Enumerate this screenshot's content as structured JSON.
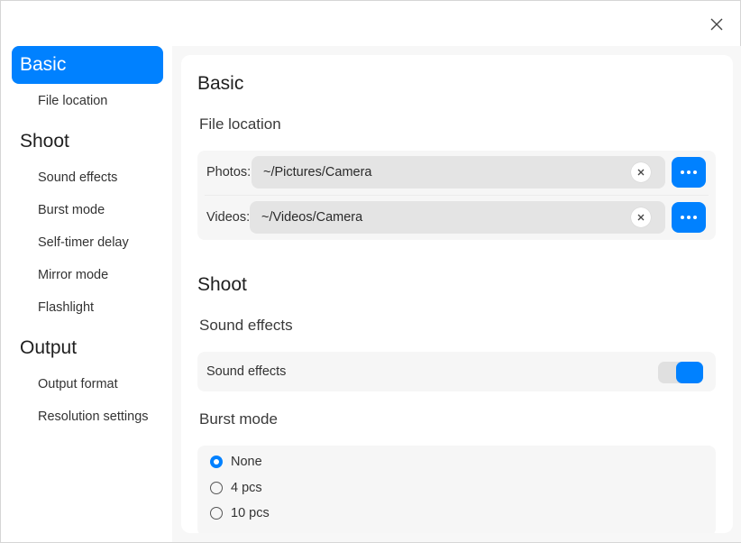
{
  "window": {
    "accent_color": "#0081ff"
  },
  "icons": {
    "close": "close-icon",
    "clear": "clear-icon",
    "more": "more-dots-icon"
  },
  "sidebar": {
    "groups": [
      {
        "label": "Basic",
        "active": true,
        "items": [
          "File location"
        ]
      },
      {
        "label": "Shoot",
        "active": false,
        "items": [
          "Sound effects",
          "Burst mode",
          "Self-timer delay",
          "Mirror mode",
          "Flashlight"
        ]
      },
      {
        "label": "Output",
        "active": false,
        "items": [
          "Output format",
          "Resolution settings"
        ]
      }
    ]
  },
  "content": {
    "basic": {
      "title": "Basic",
      "file_location": {
        "title": "File location",
        "photos": {
          "label": "Photos:",
          "value": "~/Pictures/Camera"
        },
        "videos": {
          "label": "Videos:",
          "value": "~/Videos/Camera"
        }
      }
    },
    "shoot": {
      "title": "Shoot",
      "sound_effects": {
        "title": "Sound effects",
        "label": "Sound effects",
        "enabled": true
      },
      "burst_mode": {
        "title": "Burst mode",
        "options": [
          "None",
          "4 pcs",
          "10 pcs"
        ],
        "selected": "None"
      }
    }
  }
}
